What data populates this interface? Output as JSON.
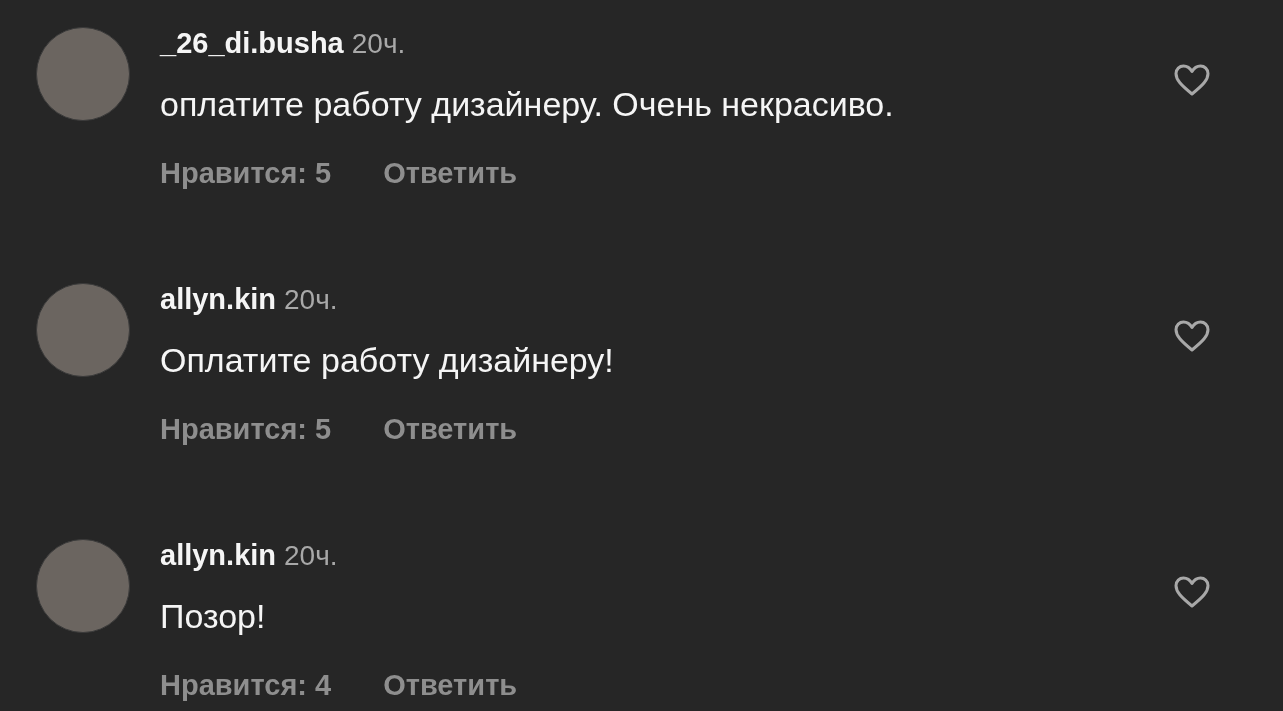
{
  "comments": [
    {
      "username": "_26_di.busha",
      "time": "20ч.",
      "text": "оплатите работу дизайнеру. Очень некрасиво.",
      "likes": "Нравится: 5",
      "reply": "Ответить",
      "liked": false
    },
    {
      "username": "allyn.kin",
      "time": "20ч.",
      "text": "Оплатите работу дизайнеру!",
      "likes": "Нравится: 5",
      "reply": "Ответить",
      "liked": false
    },
    {
      "username": "allyn.kin",
      "time": "20ч.",
      "text": "Позор!",
      "likes": "Нравится: 4",
      "reply": "Ответить",
      "liked": false
    }
  ]
}
